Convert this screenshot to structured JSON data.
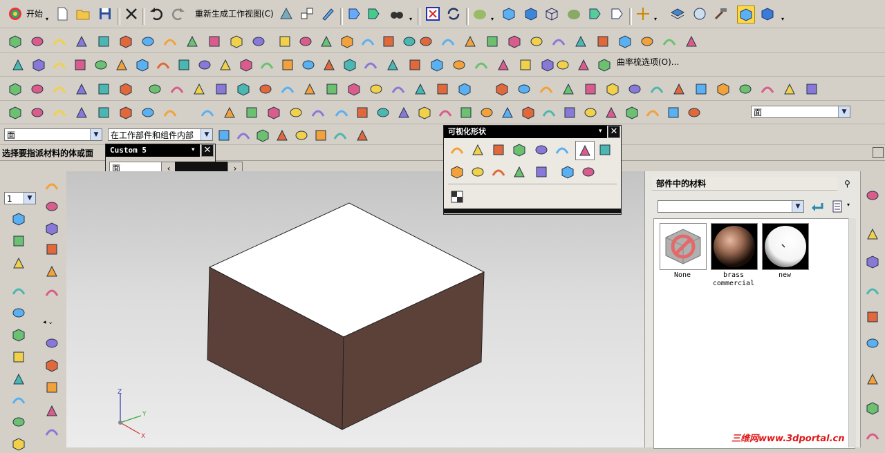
{
  "toolbar1": {
    "start_label": "开始",
    "regen_label": "重新生成工作视图(C)"
  },
  "toolbar3": {
    "curvature_comb_label": "曲率梳选项(O)..."
  },
  "toolbar5": {
    "face_filter_value": "面"
  },
  "selection_bar": {
    "type_filter": "面",
    "scope_filter": "在工作部件和组件内部"
  },
  "status": {
    "prompt": "选择要指派材料的体或面"
  },
  "custom_panel": {
    "title": "Custom 5",
    "field_value": "面"
  },
  "viz_panel": {
    "title": "可视化形状"
  },
  "materials_panel": {
    "title": "部件中的材料",
    "search_value": "",
    "materials": [
      {
        "name": "None",
        "icon": "none-material-icon"
      },
      {
        "name": "brass\ncommercial",
        "icon": "brass-sphere-icon"
      },
      {
        "name": "new",
        "icon": "white-sphere-icon"
      }
    ]
  },
  "left_palette": {
    "layer_value": "1"
  },
  "watermark": "三维网www.3dportal.cn",
  "colors": {
    "ui_gray": "#d4d0c8",
    "block_side": "#5a4038",
    "block_top": "#ffffff",
    "panel_title_bg": "#000000",
    "highlight": "#ffd84a"
  }
}
